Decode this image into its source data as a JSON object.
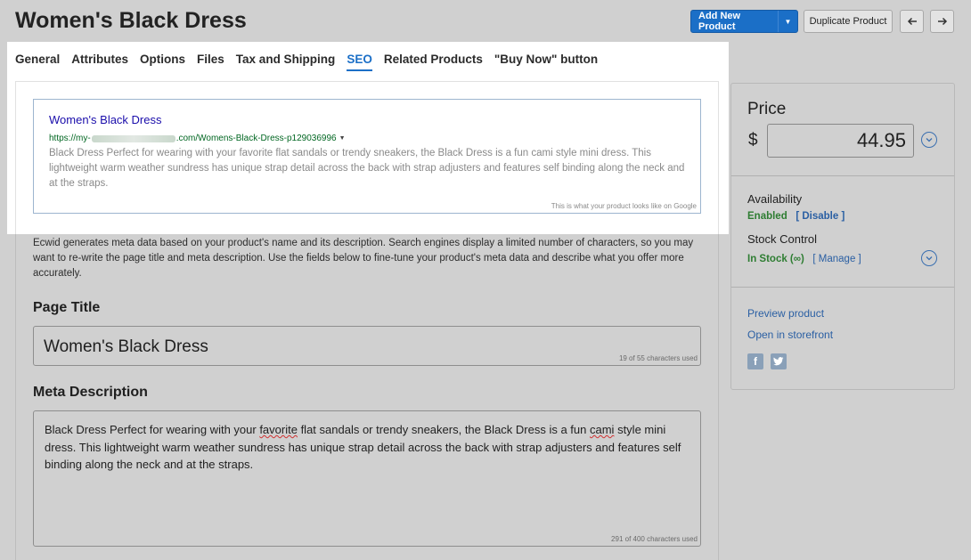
{
  "header": {
    "title": "Women's Black Dress",
    "add_new_label": "Add New Product",
    "duplicate_label": "Duplicate Product",
    "prev_icon": "arrow-left-icon",
    "next_icon": "arrow-right-icon"
  },
  "tabs": [
    {
      "label": "General",
      "active": false
    },
    {
      "label": "Attributes",
      "active": false
    },
    {
      "label": "Options",
      "active": false
    },
    {
      "label": "Files",
      "active": false
    },
    {
      "label": "Tax and Shipping",
      "active": false
    },
    {
      "label": "SEO",
      "active": true
    },
    {
      "label": "Related Products",
      "active": false
    },
    {
      "label": "\"Buy Now\" button",
      "active": false
    }
  ],
  "google_preview": {
    "title": "Women's Black Dress",
    "url_prefix": "https://my-",
    "url_suffix": ".com/Womens-Black-Dress-p129036996",
    "description": "Black Dress Perfect for wearing with your favorite flat sandals or trendy sneakers, the Black Dress is a fun cami style mini dress. This lightweight warm weather sundress has unique strap detail across the back with strap adjusters and features self binding along the neck and at the straps.",
    "note": "This is what your product looks like on Google"
  },
  "seo": {
    "info": "Ecwid generates meta data based on your product's name and its description. Search engines display a limited number of characters, so you may want to re-write the page title and meta description. Use the fields below to fine-tune your product's meta data and describe what you offer more accurately.",
    "page_title_label": "Page Title",
    "page_title_value": "Women's Black Dress",
    "page_title_counter": "19 of 55 characters used",
    "meta_label": "Meta Description",
    "meta_part1": "Black Dress Perfect for wearing with your ",
    "meta_spell1": "favorite",
    "meta_part2": " flat sandals or trendy sneakers, the Black Dress is a fun ",
    "meta_spell2": "cami",
    "meta_part3": " style mini dress. This lightweight warm weather sundress has unique strap detail across the back with strap adjusters and features self binding along the neck and at the straps.",
    "meta_counter": "291 of 400 characters used"
  },
  "sidebar": {
    "price_label": "Price",
    "currency": "$",
    "price_value": "44.95",
    "availability_label": "Availability",
    "availability_status": "Enabled",
    "availability_action": "[ Disable ]",
    "stock_label": "Stock Control",
    "stock_status": "In Stock (∞)",
    "stock_action": "[ Manage ]",
    "preview_link": "Preview product",
    "storefront_link": "Open in storefront",
    "facebook": "f",
    "twitter_icon": "twitter-icon"
  },
  "colors": {
    "accent": "#1b6fc7",
    "status_green": "#2e7d32",
    "google_title": "#1a0dab",
    "google_url": "#006621"
  }
}
